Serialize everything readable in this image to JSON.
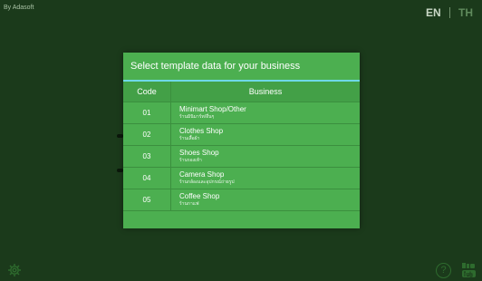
{
  "header": {
    "credit": "By Adasoft",
    "lang_en": "EN",
    "lang_th": "TH"
  },
  "dialog": {
    "title": "Select template data for your business",
    "columns": {
      "code": "Code",
      "business": "Business"
    },
    "rows": [
      {
        "code": "01",
        "name": "Minimart Shop/Other",
        "name_th": "ร้านมินิมาร์ท/อื่นๆ"
      },
      {
        "code": "02",
        "name": "Clothes Shop",
        "name_th": "ร้านเสื้อผ้า"
      },
      {
        "code": "03",
        "name": "Shoes Shop",
        "name_th": "ร้านรองเท้า"
      },
      {
        "code": "04",
        "name": "Camera Shop",
        "name_th": "ร้านกล้องและอุปกรณ์ถ่ายรูป"
      },
      {
        "code": "05",
        "name": "Coffee Shop",
        "name_th": "ร้านกาแฟ"
      }
    ]
  },
  "footer": {
    "help_label": "?"
  },
  "icons": {
    "settings": "gear-icon",
    "help": "help-icon",
    "youtube": "youtube-icon"
  }
}
